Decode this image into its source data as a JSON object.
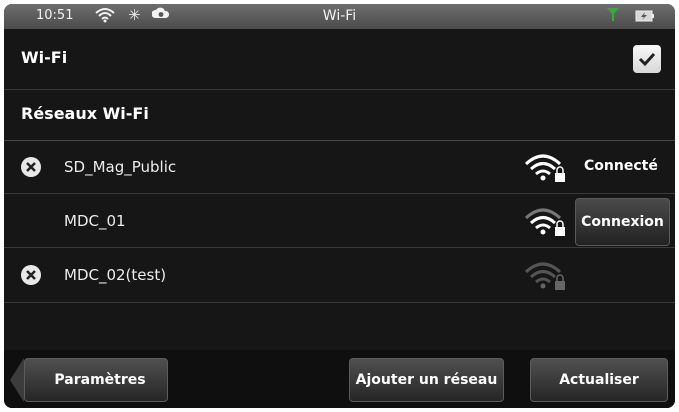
{
  "status_bar": {
    "time": "10:51",
    "title": "Wi-Fi",
    "icons": [
      "wifi-icon",
      "bluetooth-icon",
      "sync-icon",
      "signal-icon",
      "battery-charging-icon"
    ]
  },
  "wifi_toggle": {
    "label": "Wi-Fi",
    "checked": true
  },
  "networks_header": "Réseaux Wi-Fi",
  "networks": [
    {
      "name": "SD_Mag_Public",
      "status": "Connecté",
      "forget_icon": true,
      "signal": "strong"
    },
    {
      "name": "MDC_01",
      "action": "Connexion",
      "forget_icon": false,
      "signal": "medium"
    },
    {
      "name": "MDC_02(test)",
      "forget_icon": true,
      "signal": "weak"
    }
  ],
  "bottom_bar": {
    "settings": "Paramètres",
    "add_network": "Ajouter un réseau",
    "refresh": "Actualiser"
  },
  "colors": {
    "background": "#161616",
    "status_bar": "#5a5a5a",
    "signal_green": "#3ea83e"
  }
}
